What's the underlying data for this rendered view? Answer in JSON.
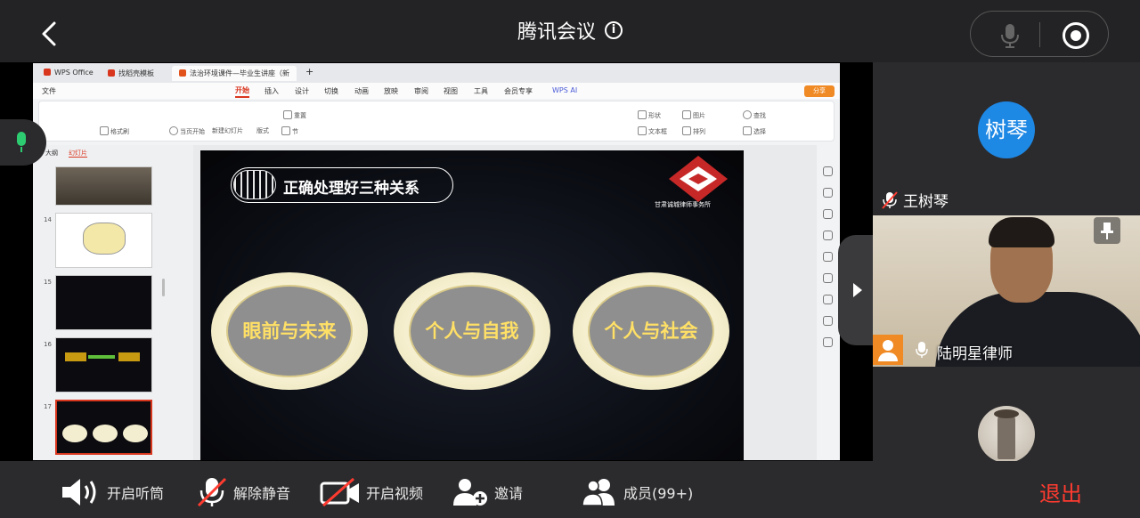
{
  "header": {
    "title": "腾讯会议",
    "info_icon": "info-icon"
  },
  "wps": {
    "tabs": [
      {
        "label": "WPS Office"
      },
      {
        "label": "找稻壳模板"
      },
      {
        "label": "法治环境课件—毕业生讲座（新"
      }
    ],
    "menu": [
      "文件",
      "开始",
      "插入",
      "设计",
      "切换",
      "动画",
      "放映",
      "审阅",
      "视图",
      "工具",
      "会员专享",
      "WPS AI"
    ],
    "active_menu": "开始",
    "share_label": "分享",
    "ribbon": {
      "format_brush": "格式刷",
      "from_current": "当页开始",
      "new_slide": "新建幻灯片",
      "layout": "版式",
      "section": "节",
      "reset": "重置",
      "shape": "形状",
      "picture": "图片",
      "textbox": "文本框",
      "arrange": "排列",
      "find": "查找",
      "select": "选择"
    },
    "pane_tabs": [
      "大纲",
      "幻灯片"
    ],
    "thumbnails": [
      "14",
      "15",
      "16",
      "17"
    ],
    "slide": {
      "title": "正确处理好三种关系",
      "logo_text": "甘肃诚城律师事务所",
      "ovals": [
        "眼前与未来",
        "个人与自我",
        "个人与社会"
      ]
    }
  },
  "participants": {
    "p1_avatar": "树琴",
    "p1_name": "王树琴",
    "p2_name": "陆明星律师"
  },
  "toolbar": {
    "speaker": "开启听筒",
    "unmute": "解除静音",
    "video": "开启视频",
    "invite": "邀请",
    "members": "成员(99+)",
    "exit": "退出"
  },
  "colors": {
    "accent_exit": "#ff3b30",
    "wps_active": "#d9361e",
    "avatar_blue": "#1e88e5",
    "mic_active": "#2ecc71"
  }
}
